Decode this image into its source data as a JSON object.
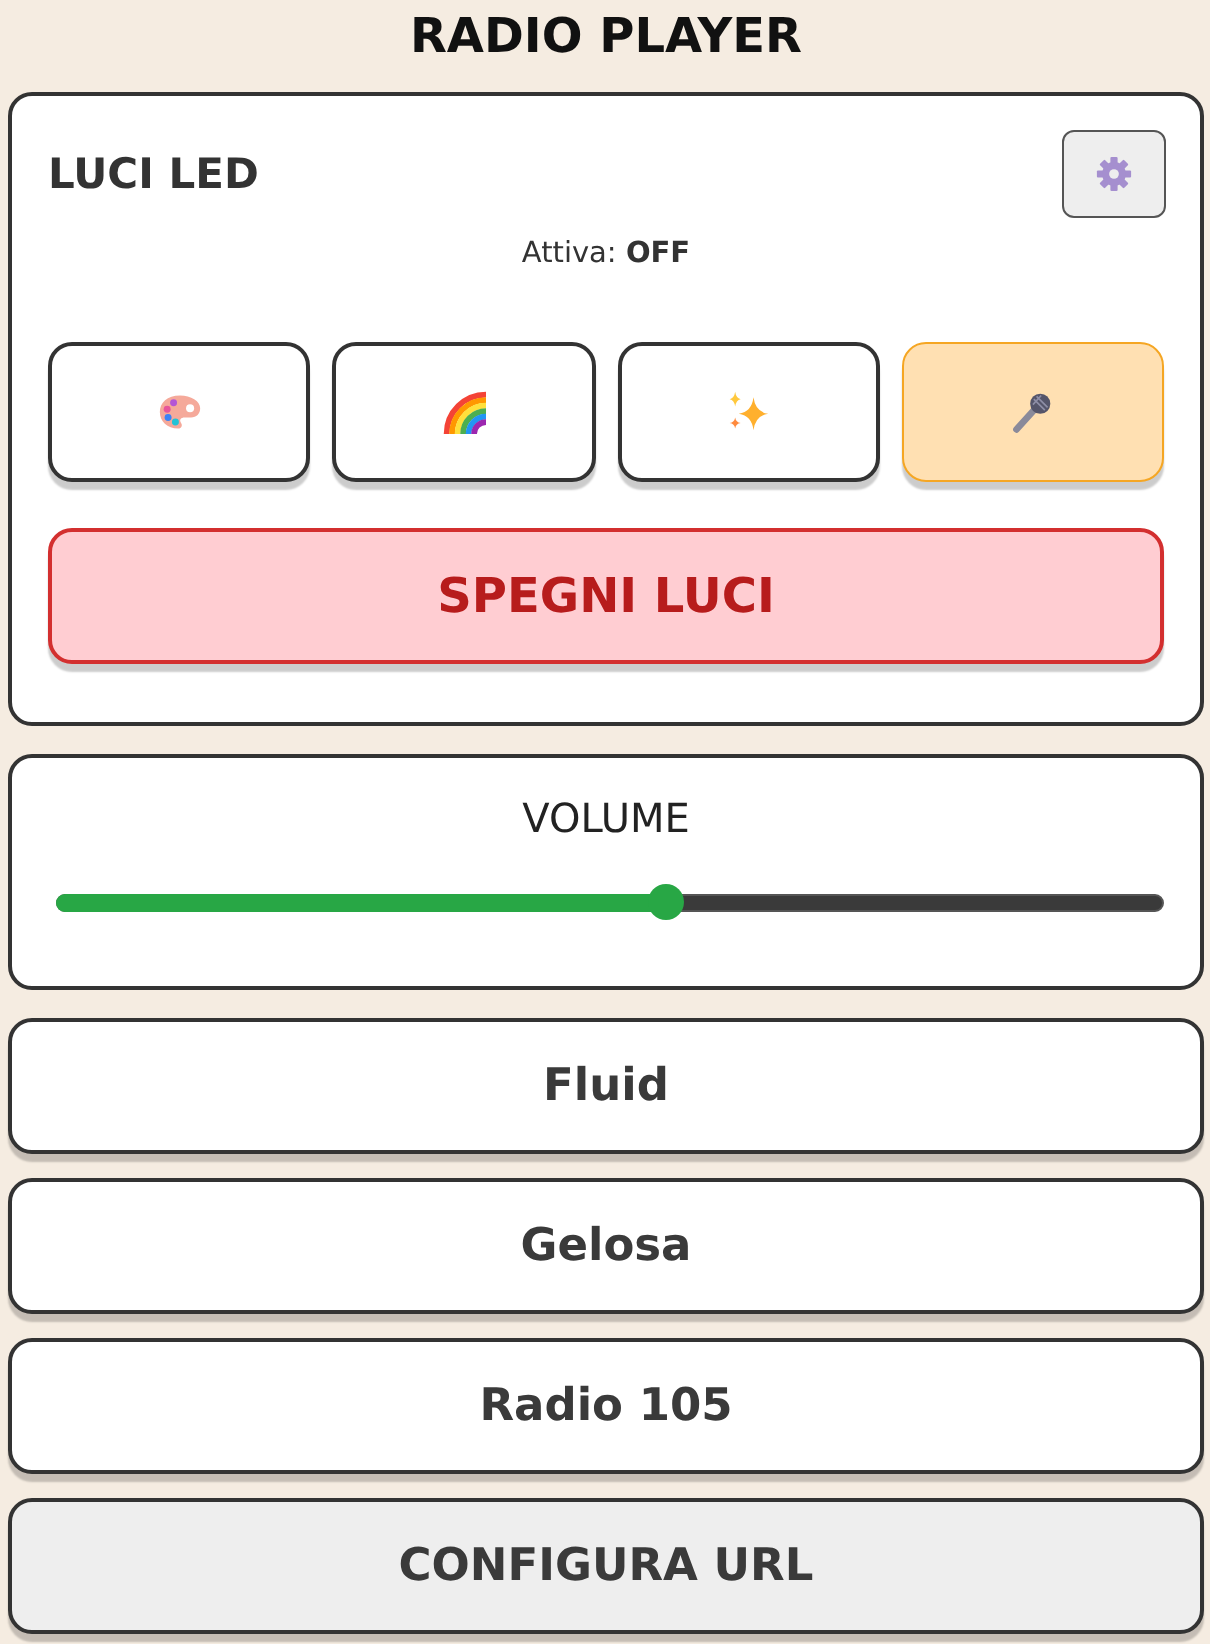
{
  "title": "RADIO PLAYER",
  "led_panel": {
    "title": "LUCI LED",
    "status": "Attiva: **OFF**",
    "modes": [
      {
        "kind": "palette",
        "selected": false
      },
      {
        "kind": "rainbow",
        "selected": false
      },
      {
        "kind": "sparkles",
        "selected": false
      },
      {
        "kind": "microphone",
        "selected": true
      }
    ],
    "off_button": "SPEGNI LUCI"
  },
  "volume": {
    "label": "VOLUME",
    "level": 0.55
  },
  "stations": [
    "Fluid",
    "Gelosa",
    "Radio 105"
  ],
  "config_button": "CONFIGURA URL"
}
